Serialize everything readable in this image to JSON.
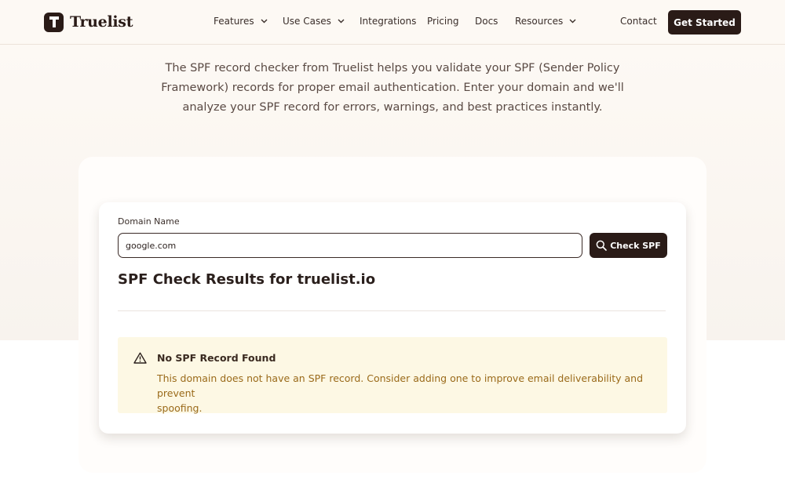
{
  "brand": {
    "name": "Truelist",
    "logo_letter": "T"
  },
  "nav": {
    "items": [
      {
        "label": "Features",
        "has_dropdown": true
      },
      {
        "label": "Use Cases",
        "has_dropdown": true
      },
      {
        "label": "Integrations",
        "has_dropdown": false
      },
      {
        "label": "Pricing",
        "has_dropdown": false
      },
      {
        "label": "Docs",
        "has_dropdown": false
      },
      {
        "label": "Resources",
        "has_dropdown": true
      }
    ],
    "contact": "Contact",
    "cta": "Get Started"
  },
  "intro": {
    "line1": "The SPF record checker from Truelist helps you validate your SPF (Sender Policy",
    "line2": "Framework) records for proper email authentication. Enter your domain and we'll",
    "line3": "analyze your SPF record for errors, warnings, and best practices instantly."
  },
  "form": {
    "label": "Domain Name",
    "value": "google.com",
    "button": "Check SPF"
  },
  "results": {
    "title": "SPF Check Results for truelist.io",
    "alert": {
      "title": "No SPF Record Found",
      "line1": "This domain does not have an SPF record. Consider adding one to improve email deliverability and prevent",
      "line2": "spoofing."
    }
  },
  "colors": {
    "brand_dark": "#2a1b17",
    "hero_bg": "#fdf9f4",
    "alert_bg": "#fdf8e4",
    "alert_text": "#9a6a1a"
  }
}
